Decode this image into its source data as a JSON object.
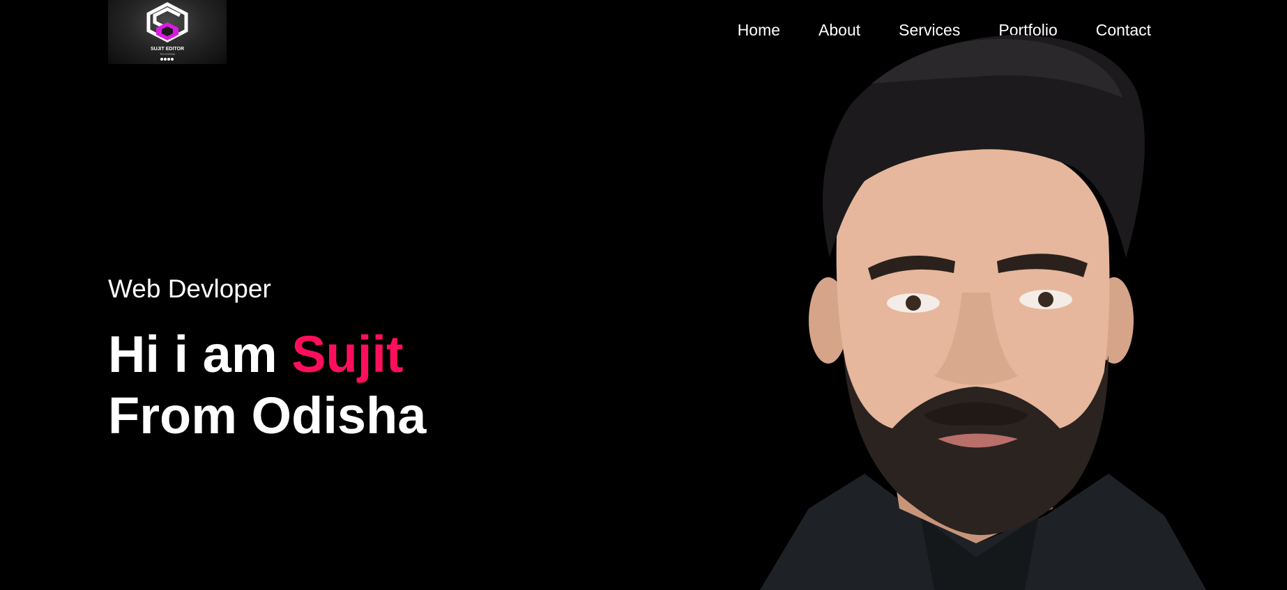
{
  "brand": {
    "logo_icon": "sujit-editor-logo-icon",
    "logo_text": "SUJIT EDITOR",
    "logo_subtext": "TELEGRAM"
  },
  "nav": {
    "items": [
      {
        "label": "Home"
      },
      {
        "label": "About"
      },
      {
        "label": "Services"
      },
      {
        "label": "Portfolio"
      },
      {
        "label": "Contact"
      }
    ]
  },
  "hero": {
    "subtitle": "Web Devloper",
    "title_prefix": "Hi i am ",
    "title_name": "Sujit",
    "title_line2": "From Odisha"
  },
  "colors": {
    "background": "#000000",
    "text": "#ffffff",
    "accent": "#ff0f5b",
    "logo_accent": "#d81be0"
  }
}
